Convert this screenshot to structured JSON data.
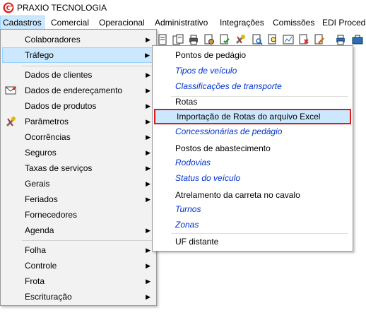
{
  "app": {
    "title": "PRAXIO TECNOLOGIA",
    "logo_icon": "praxio-logo-icon",
    "logo_color": "#d9261c"
  },
  "menubar": [
    "Cadastros",
    "Comercial",
    "Operacional",
    "Administrativo",
    "Integrações",
    "Comissões",
    "EDI Proceda"
  ],
  "cadastros_menu": {
    "items": [
      {
        "label": "Colaboradores",
        "icon": "none",
        "submenu": true
      },
      {
        "label": "Tráfego",
        "icon": "none",
        "submenu": true,
        "highlighted": true
      },
      {
        "label": "Dados de clientes",
        "icon": "none",
        "submenu": true
      },
      {
        "label": "Dados de endereçamento",
        "icon": "envelope-icon",
        "submenu": true
      },
      {
        "label": "Dados de produtos",
        "icon": "none",
        "submenu": true
      },
      {
        "label": "Parâmetros",
        "icon": "tools-icon",
        "submenu": true
      },
      {
        "label": "Ocorrências",
        "icon": "none",
        "submenu": true
      },
      {
        "label": "Seguros",
        "icon": "none",
        "submenu": true
      },
      {
        "label": "Taxas de serviços",
        "icon": "none",
        "submenu": true
      },
      {
        "label": "Gerais",
        "icon": "none",
        "submenu": true
      },
      {
        "label": "Feriados",
        "icon": "none",
        "submenu": true
      },
      {
        "label": "Fornecedores",
        "icon": "none",
        "submenu": false
      },
      {
        "label": "Agenda",
        "icon": "none",
        "submenu": true
      },
      {
        "label": "Folha",
        "icon": "none",
        "submenu": true
      },
      {
        "label": "Controle",
        "icon": "none",
        "submenu": true
      },
      {
        "label": "Frota",
        "icon": "none",
        "submenu": true
      },
      {
        "label": "Escrituração",
        "icon": "none",
        "submenu": true
      }
    ]
  },
  "trafego_menu": {
    "items": [
      {
        "label": "Pontos de pedágio",
        "style": "normal"
      },
      {
        "label": "Tipos de veículo",
        "style": "link"
      },
      {
        "label": "Classificações de transporte",
        "style": "link"
      },
      {
        "label": "Rotas",
        "style": "normal"
      },
      {
        "label": "Importação de Rotas do arquivo Excel",
        "style": "selected"
      },
      {
        "label": "Concessionárias de pedágio",
        "style": "link"
      },
      {
        "label": "Postos de abastecimento",
        "style": "normal"
      },
      {
        "label": "Rodovias",
        "style": "link"
      },
      {
        "label": "Status do veículo",
        "style": "link"
      },
      {
        "label": "Atrelamento da carreta no cavalo",
        "style": "normal"
      },
      {
        "label": "Turnos",
        "style": "link"
      },
      {
        "label": "Zonas",
        "style": "link"
      },
      {
        "label": "UF distante",
        "style": "normal"
      }
    ]
  },
  "toolbar_icons": [
    "document-icon",
    "documents-icon",
    "printer-icon",
    "document-gear-icon",
    "document-check-icon",
    "tools-icon",
    "magnifier-document-icon",
    "search-doc-icon",
    "report-icon",
    "close-doc-icon",
    "edit-doc-icon",
    "printer-color-icon",
    "toolbox-icon"
  ],
  "colors": {
    "highlight_bg": "#cce8ff",
    "highlight_border": "#99d1ff",
    "selection_outline": "#e01818",
    "link_text": "#0033cc"
  }
}
